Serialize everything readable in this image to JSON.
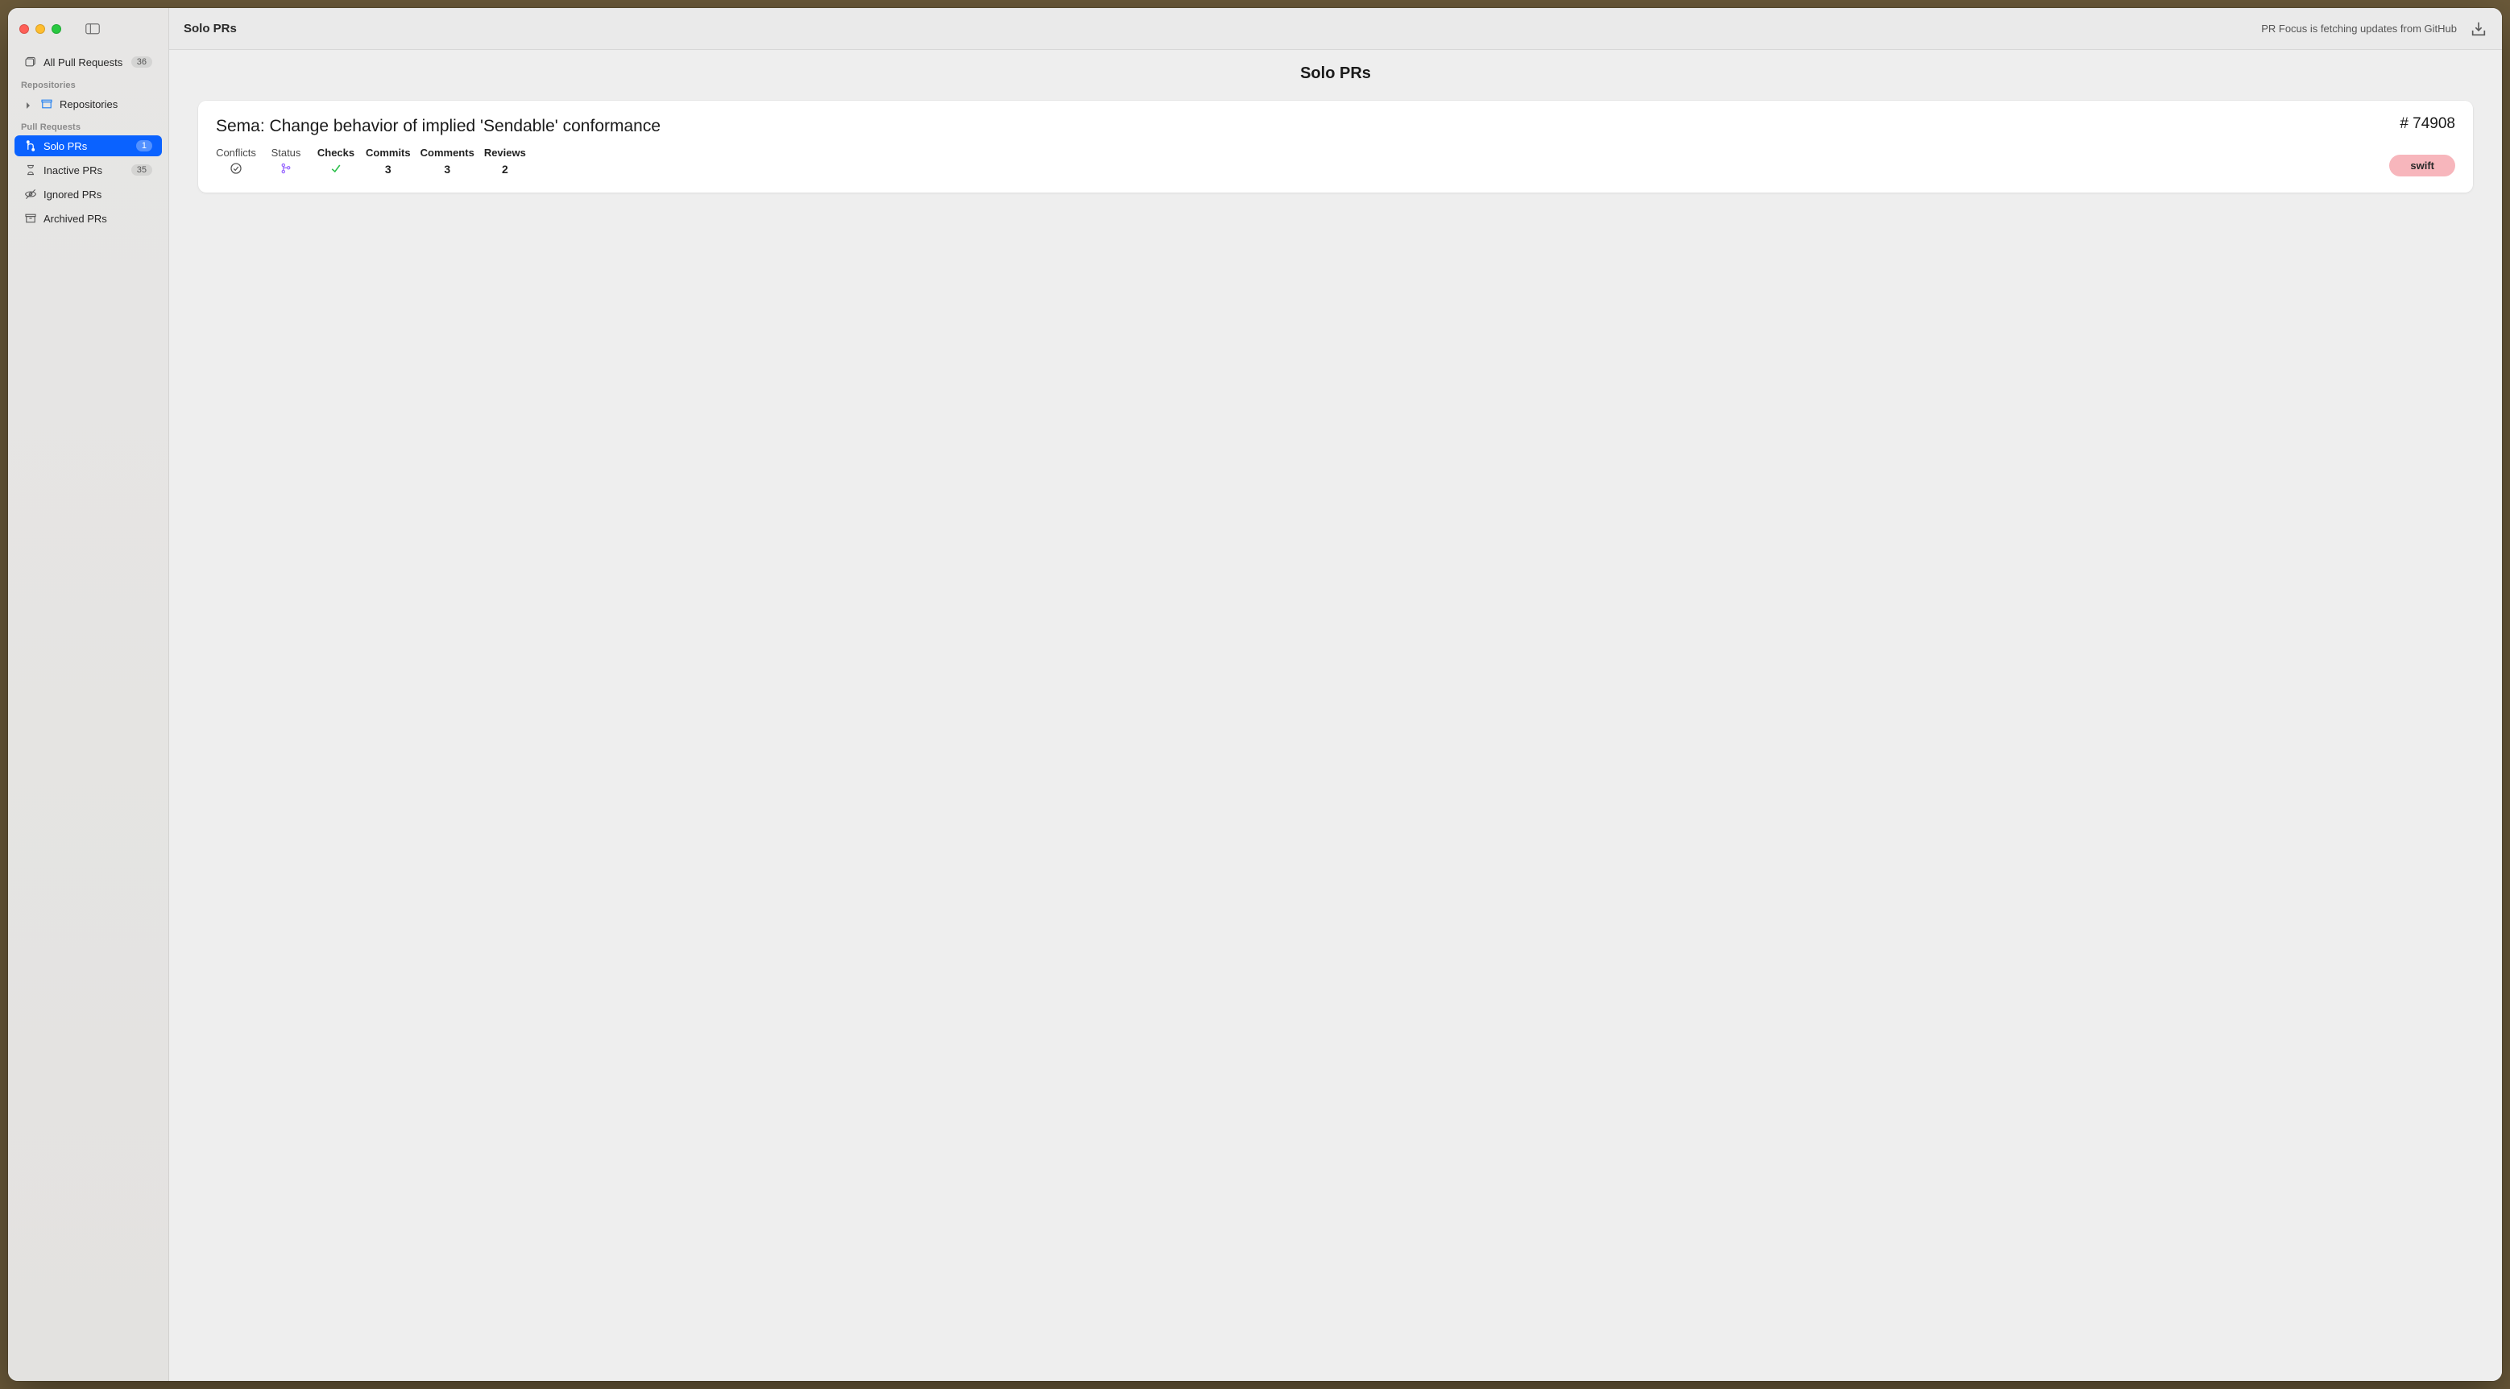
{
  "window": {
    "title": "Solo PRs",
    "status": "PR Focus is fetching updates from GitHub"
  },
  "sidebar": {
    "all_prs": {
      "label": "All Pull Requests",
      "badge": "36"
    },
    "sections": {
      "repos_header": "Repositories",
      "prs_header": "Pull Requests"
    },
    "repos_item": {
      "label": "Repositories"
    },
    "pr_items": [
      {
        "id": "solo",
        "label": "Solo PRs",
        "badge": "1"
      },
      {
        "id": "inactive",
        "label": "Inactive PRs",
        "badge": "35"
      },
      {
        "id": "ignored",
        "label": "Ignored PRs",
        "badge": ""
      },
      {
        "id": "archived",
        "label": "Archived PRs",
        "badge": ""
      }
    ]
  },
  "page": {
    "heading": "Solo PRs"
  },
  "pr": {
    "title": "Sema: Change behavior of implied 'Sendable' conformance",
    "number": "# 74908",
    "tag": "swift",
    "stats": {
      "conflicts": {
        "label": "Conflicts",
        "bold": false
      },
      "status": {
        "label": "Status",
        "bold": false
      },
      "checks": {
        "label": "Checks",
        "bold": true
      },
      "commits": {
        "label": "Commits",
        "bold": true,
        "value": "3"
      },
      "comments": {
        "label": "Comments",
        "bold": true,
        "value": "3"
      },
      "reviews": {
        "label": "Reviews",
        "bold": true,
        "value": "2"
      }
    }
  }
}
